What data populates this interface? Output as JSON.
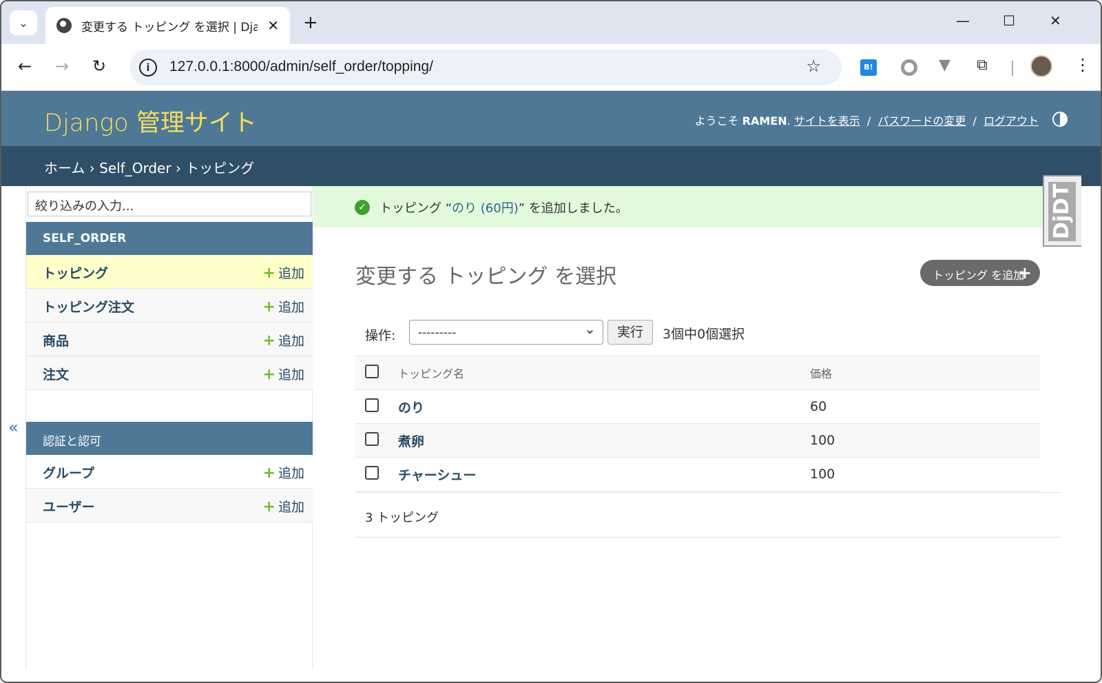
{
  "browser": {
    "tab_title": "変更する トッピング を選択 | Djang",
    "url": "127.0.0.1:8000/admin/self_order/topping/",
    "new_tab": "+",
    "close": "✕"
  },
  "header": {
    "branding": "Django 管理サイト",
    "welcome": "ようこそ",
    "username": "RAMEN",
    "view_site": "サイトを表示",
    "change_password": "パスワードの変更",
    "logout": "ログアウト",
    "sep": "/"
  },
  "breadcrumbs": {
    "home": "ホーム",
    "app": "Self_Order",
    "model": "トッピング",
    "sep": "›"
  },
  "sidebar": {
    "collapse_icon": "«",
    "filter_placeholder": "絞り込みの入力...",
    "apps": [
      {
        "caption": "SELF_ORDER",
        "models": [
          {
            "name": "トッピング",
            "add": "追加"
          },
          {
            "name": "トッピング注文",
            "add": "追加"
          },
          {
            "name": "商品",
            "add": "追加"
          },
          {
            "name": "注文",
            "add": "追加"
          }
        ]
      },
      {
        "caption": "認証と認可",
        "models": [
          {
            "name": "グループ",
            "add": "追加"
          },
          {
            "name": "ユーザー",
            "add": "追加"
          }
        ]
      }
    ]
  },
  "message": {
    "prefix": "トッピング “",
    "link": "のり (60円)",
    "suffix": "” を追加しました。"
  },
  "content": {
    "title": "変更する トッピング を選択",
    "add_button": "トッピング を追加",
    "action_label": "操作:",
    "action_value": "---------",
    "run": "実行",
    "counter": "3個中0個選択",
    "columns": [
      "トッピング名",
      "価格"
    ],
    "rows": [
      {
        "name": "のり",
        "price": "60"
      },
      {
        "name": "煮卵",
        "price": "100"
      },
      {
        "name": "チャーシュー",
        "price": "100"
      }
    ],
    "paginator": "3 トッピング"
  },
  "djdt": "DjDT",
  "colors": {
    "header": "#4f7896",
    "breadcrumbs": "#2f4f66",
    "branding": "#f5dd5d",
    "success": "#e3f9dc"
  }
}
